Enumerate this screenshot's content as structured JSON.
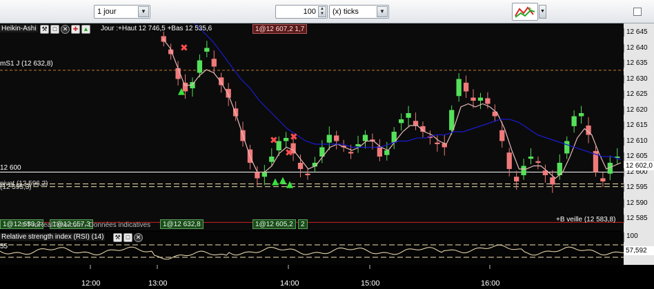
{
  "toolbar": {
    "period": "1 jour",
    "count": "100",
    "unit": "(x) ticks"
  },
  "panel": {
    "title": "Heikin-Ashi",
    "header_info": "Jour :+Haut 12 746,5 +Bas 12 535,6",
    "top_trade_tag": "1@12 607,2 1,7",
    "pivot_s1": "mS1 J (12 632,8)",
    "level_12600": "12 600",
    "pivot_label": "pivot (12 596,2)",
    "pivot_label2": "(12 595,3)",
    "veille": "+B veille (12 583,8)",
    "copyright": "© ProRealTime.com - Données indicatives",
    "bottom_tag_1": "1@12 632,8",
    "bottom_tag_2": "1@12 605,2",
    "bottom_tag_2b": "2",
    "bottom_tag_left": "1@12 653,2",
    "bottom_tag_left2": "1@12 657,3",
    "current_price": "12 602,0"
  },
  "y_axis": [
    "12 645",
    "12 640",
    "12 635",
    "12 630",
    "12 625",
    "12 620",
    "12 615",
    "12 610",
    "12 605",
    "12 600",
    "12 595",
    "12 590",
    "12 585"
  ],
  "rsi": {
    "title": "Relative strength index (RSI) (14)",
    "level_top": "55",
    "right_100": "100",
    "current": "57,592"
  },
  "x_axis": [
    "12:00",
    "13:00",
    "14:00",
    "15:00",
    "16:00"
  ],
  "colors": {
    "bull": "#55e05a",
    "bear": "#f07a7a",
    "ma_fast": "#e8b8b8",
    "ma_slow": "#1b1bd0",
    "pivot_line": "#c47c2a",
    "dashed": "#f2e2b0"
  },
  "chart_data": {
    "type": "candlestick",
    "title": "Heikin-Ashi",
    "ylim": [
      12583,
      12647
    ],
    "y_ticks": [
      12645,
      12640,
      12635,
      12630,
      12625,
      12620,
      12615,
      12610,
      12605,
      12600,
      12595,
      12590,
      12585
    ],
    "x_ticks": [
      "12:00",
      "13:00",
      "14:00",
      "15:00",
      "16:00"
    ],
    "series": [
      {
        "name": "close",
        "values": [
          12642,
          12638,
          12630,
          12626,
          12629,
          12636,
          12640,
          12634,
          12628,
          12624,
          12618,
          12610,
          12603,
          12598,
          12600,
          12605,
          12610,
          12611,
          12606,
          12601,
          12599,
          12603,
          12608,
          12612,
          12610,
          12608,
          12606,
          12609,
          12612,
          12610,
          12605,
          12607,
          12613,
          12617,
          12619,
          12615,
          12613,
          12611,
          12609,
          12608,
          12620,
          12630,
          12626,
          12623,
          12624,
          12622,
          12618,
          12610,
          12601,
          12597,
          12602,
          12605,
          12603,
          12599,
          12596,
          12603,
          12610,
          12618,
          12619,
          12612,
          12600,
          12597,
          12603,
          12605
        ]
      },
      {
        "name": "ma_fast",
        "values": [
          12643,
          12640,
          12634,
          12628,
          12628,
          12631,
          12633,
          12632,
          12629,
          12625,
          12619,
          12612,
          12605,
          12600,
          12600,
          12602,
          12606,
          12608,
          12607,
          12604,
          12601,
          12602,
          12605,
          12608,
          12609,
          12608,
          12607,
          12608,
          12610,
          12610,
          12608,
          12607,
          12610,
          12613,
          12615,
          12615,
          12613,
          12612,
          12610,
          12609,
          12614,
          12621,
          12622,
          12621,
          12622,
          12621,
          12619,
          12614,
          12607,
          12601,
          12601,
          12602,
          12602,
          12600,
          12598,
          12600,
          12605,
          12611,
          12614,
          12612,
          12606,
          12601,
          12602,
          12603
        ]
      },
      {
        "name": "ma_slow",
        "values": [
          12648,
          12645,
          12642,
          12638,
          12634,
          12630,
          12627,
          12623,
          12620,
          12617,
          12614,
          12612,
          12610,
          12609,
          12609,
          12609,
          12609,
          12608,
          12608,
          12608,
          12608,
          12609,
          12610,
          12610,
          12611,
          12611,
          12612,
          12612,
          12613,
          12613,
          12614,
          12615,
          12616,
          12617,
          12617,
          12616,
          12614,
          12612,
          12611,
          12610,
          12609,
          12608,
          12607,
          12606,
          12605,
          12605,
          12604
        ]
      }
    ],
    "levels": [
      {
        "name": "mS1 J",
        "value": 12632.8
      },
      {
        "name": "pivot",
        "value": 12596.2
      },
      {
        "name": "level",
        "value": 12600
      },
      {
        "name": "B veille",
        "value": 12583.8
      }
    ],
    "rsi": {
      "ylim": [
        0,
        100
      ],
      "current": 57.592
    }
  }
}
